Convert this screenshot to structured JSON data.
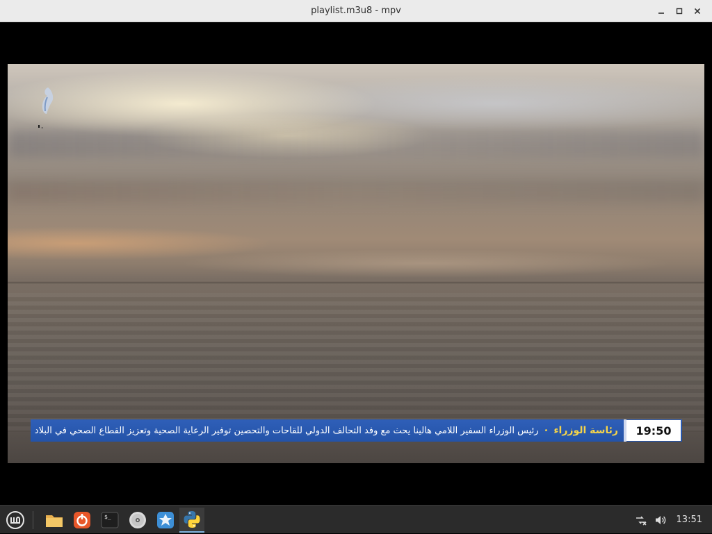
{
  "window": {
    "title": "playlist.m3u8 - mpv"
  },
  "window_controls": [
    "minimize-icon",
    "maximize-icon",
    "close-icon"
  ],
  "video": {
    "ticker": {
      "time": "19:50",
      "source": "رئاسة الوزراء",
      "bullet": "•",
      "headline": "رئيس الوزراء السفير اللامي هالينا يحث مع وفد التحالف الدولي للقاحات والتحصين توفير الرعاية الصحية وتعزيز القطاع الصحي في البلاد"
    },
    "colors": {
      "ticker_bg": "#2453a8",
      "ticker_source": "#f5d44a"
    }
  },
  "taskbar": {
    "items": [
      {
        "name": "menu-icon"
      },
      {
        "name": "files-icon"
      },
      {
        "name": "software-update-icon"
      },
      {
        "name": "terminal-icon"
      },
      {
        "name": "disc-icon"
      },
      {
        "name": "app-icon"
      },
      {
        "name": "python-icon",
        "active": true
      }
    ],
    "tray": {
      "network": "network-disconnected-icon",
      "volume": "volume-icon",
      "clock": "13:51"
    }
  }
}
